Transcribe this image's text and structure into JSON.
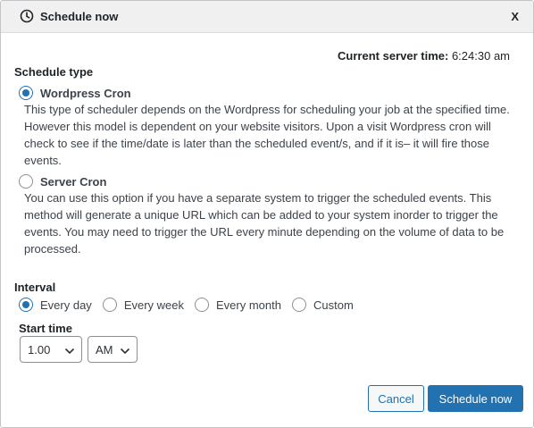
{
  "header": {
    "title": "Schedule now",
    "close_label": "X",
    "icon": "clock-icon"
  },
  "server_time": {
    "label": "Current server time:",
    "value": "6:24:30 am"
  },
  "schedule_type": {
    "title": "Schedule type",
    "options": [
      {
        "label": "Wordpress Cron",
        "checked": true,
        "description": "This type of scheduler depends on the Wordpress for scheduling your job at the specified time. However this model is dependent on your website visitors. Upon a visit Wordpress cron will check to see if the time/date is later than the scheduled event/s, and if it is– it will fire those events."
      },
      {
        "label": "Server Cron",
        "checked": false,
        "description": "You can use this option if you have a separate system to trigger the scheduled events. This method will generate a unique URL which can be added to your system inorder to trigger the events. You may need to trigger the URL every minute depending on the volume of data to be processed."
      }
    ]
  },
  "interval": {
    "title": "Interval",
    "options": [
      {
        "label": "Every day",
        "checked": true
      },
      {
        "label": "Every week",
        "checked": false
      },
      {
        "label": "Every month",
        "checked": false
      },
      {
        "label": "Custom",
        "checked": false
      }
    ]
  },
  "start_time": {
    "title": "Start time",
    "hour": "1.00",
    "meridiem": "AM"
  },
  "actions": {
    "cancel_label": "Cancel",
    "submit_label": "Schedule now"
  },
  "colors": {
    "accent": "#2271b1",
    "header_bg": "#f0f0f1",
    "text": "#1d2327"
  }
}
